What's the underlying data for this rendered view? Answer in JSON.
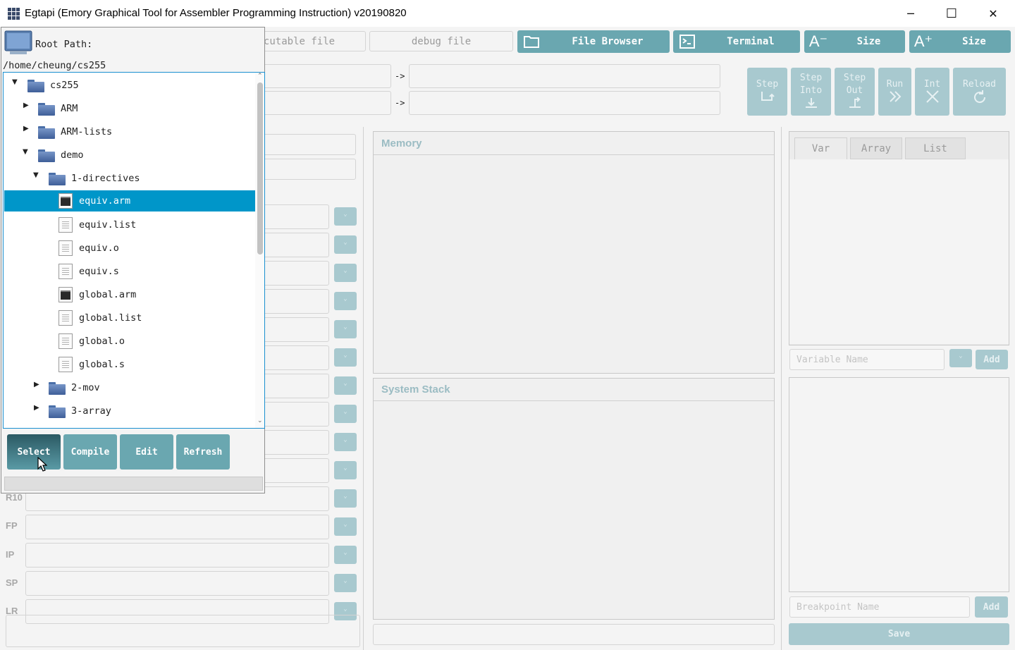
{
  "window": {
    "title": "Egtapi (Emory Graphical Tool for Assembler Programming Instruction) v20190820",
    "minimize": "─",
    "maximize": "☐",
    "close": "✕"
  },
  "toolbar": {
    "executable_placeholder": "cutable file",
    "debug_placeholder": "debug file",
    "file_browser": "File Browser",
    "terminal": "Terminal",
    "size_decrease": "Size",
    "size_increase": "Size",
    "size_decrease_icon": "A⁻",
    "size_increase_icon": "A⁺"
  },
  "mapping": {
    "arrow1": "->",
    "arrow2": "->"
  },
  "debug_buttons": {
    "step": "Step",
    "step_into_1": "Step",
    "step_into_2": "Into",
    "step_out_1": "Step",
    "step_out_2": "Out",
    "run": "Run",
    "int": "Int",
    "reload": "Reload"
  },
  "registers": {
    "r10": "R10",
    "fp": "FP",
    "ip": "IP",
    "sp": "SP",
    "lr": "LR"
  },
  "memory": {
    "title": "Memory"
  },
  "stack": {
    "title": "System Stack"
  },
  "watch": {
    "tabs": [
      "Var",
      "Array",
      "List"
    ],
    "variable_placeholder": "Variable Name",
    "add_var": "Add",
    "breakpoint_placeholder": "Breakpoint Name",
    "add_bp": "Add",
    "save": "Save"
  },
  "file_browser": {
    "root_label": "Root Path:",
    "root_path": "/home/cheung/cs255",
    "tree": [
      {
        "label": "cs255",
        "type": "folder",
        "expanded": true
      },
      {
        "label": "ARM",
        "type": "folder",
        "expanded": false
      },
      {
        "label": "ARM-lists",
        "type": "folder",
        "expanded": false
      },
      {
        "label": "demo",
        "type": "folder",
        "expanded": true
      },
      {
        "label": "1-directives",
        "type": "folder",
        "expanded": true
      },
      {
        "label": "equiv.arm",
        "type": "exec",
        "selected": true
      },
      {
        "label": "equiv.list",
        "type": "file"
      },
      {
        "label": "equiv.o",
        "type": "file"
      },
      {
        "label": "equiv.s",
        "type": "file"
      },
      {
        "label": "global.arm",
        "type": "exec"
      },
      {
        "label": "global.list",
        "type": "file"
      },
      {
        "label": "global.o",
        "type": "file"
      },
      {
        "label": "global.s",
        "type": "file"
      },
      {
        "label": "2-mov",
        "type": "folder",
        "expanded": false
      },
      {
        "label": "3-array",
        "type": "folder",
        "expanded": false
      }
    ],
    "buttons": {
      "select": "Select",
      "compile": "Compile",
      "edit": "Edit",
      "refresh": "Refresh"
    }
  },
  "colors": {
    "accent": "#6aa7b0",
    "accent_disabled": "#a8c9cf",
    "selection": "#0096c9",
    "tree_border": "#1a8fd0"
  }
}
